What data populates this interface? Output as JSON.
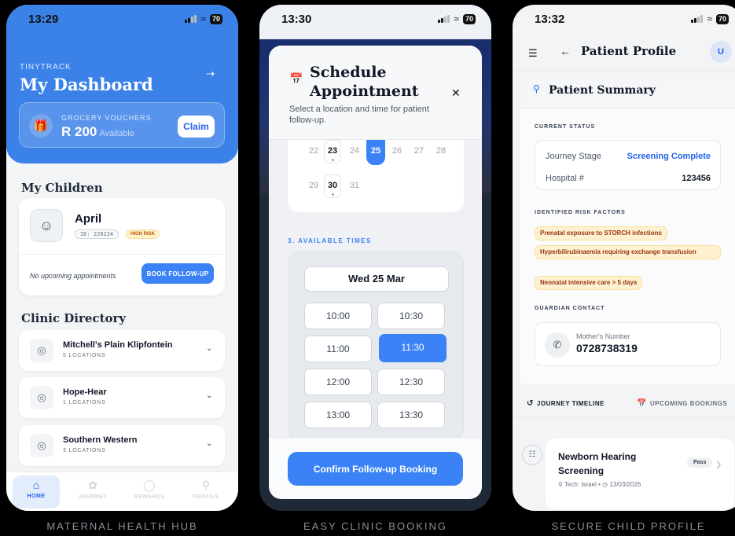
{
  "phone1": {
    "time": "13:29",
    "battery": "70",
    "brand": "TINYTRACK",
    "title": "My Dashboard",
    "voucher": {
      "label": "GROCERY VOUCHERS",
      "amount": "R 200",
      "available": "Available",
      "claim": "Claim"
    },
    "children_title": "My Children",
    "child": {
      "name": "April",
      "id": "ID: 228224",
      "risk": "HIGH RISK",
      "no_appointments": "No upcoming appointments",
      "book": "BOOK FOLLOW-UP"
    },
    "directory_title": "Clinic Directory",
    "clinics": [
      {
        "name": "Mitchell's Plain Klipfontein",
        "locations": "5 LOCATIONS"
      },
      {
        "name": "Hope-Hear",
        "locations": "1 LOCATIONS"
      },
      {
        "name": "Southern Western",
        "locations": "3 LOCATIONS"
      }
    ],
    "tabs": [
      "HOME",
      "JOURNEY",
      "REWARDS",
      "PROFILE"
    ],
    "caption": "MATERNAL HEALTH HUB"
  },
  "phone2": {
    "time": "13:30",
    "battery": "70",
    "title": "Schedule Appointment",
    "subtitle": "Select a location and time for patient follow-up.",
    "days_row1": [
      "22",
      "23",
      "24",
      "25",
      "26",
      "27",
      "28"
    ],
    "days_row2": [
      "29",
      "30",
      "31"
    ],
    "section": "3. AVAILABLE TIMES",
    "date": "Wed 25 Mar",
    "slots": [
      "10:00",
      "10:30",
      "11:00",
      "11:30",
      "12:00",
      "12:30",
      "13:00",
      "13:30"
    ],
    "confirm": "Confirm Follow-up Booking",
    "caption": "EASY CLINIC BOOKING"
  },
  "phone3": {
    "time": "13:32",
    "battery": "70",
    "title": "Patient Profile",
    "avatar": "U",
    "summary_title": "Patient Summary",
    "current_status": "CURRENT STATUS",
    "journey_stage_label": "Journey Stage",
    "journey_stage_value": "Screening Complete",
    "hospital_label": "Hospital #",
    "hospital_value": "123456",
    "risk_title": "IDENTIFIED RISK FACTORS",
    "risks": [
      "Prenatal exposure to STORCH infections",
      "Hyperbilirubinaemia requiring exchange transfusion",
      "Neonatal intensive care > 5 days"
    ],
    "guardian_title": "GUARDIAN CONTACT",
    "guardian_label": "Mother's Number",
    "guardian_number": "0728738319",
    "tab_timeline": "JOURNEY TIMELINE",
    "tab_bookings": "UPCOMING BOOKINGS",
    "timeline_title": "Newborn Hearing Screening",
    "timeline_badge": "Pass",
    "timeline_tech": "Tech: Israel •",
    "timeline_date": "13/03/2026",
    "caption": "SECURE CHILD PROFILE"
  },
  "colors": {
    "accent": "#3b82f6",
    "header": "#3b82e8",
    "risk_bg": "#fdf1d0"
  }
}
